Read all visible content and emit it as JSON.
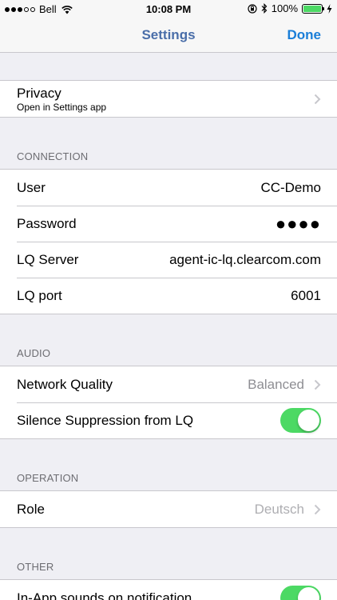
{
  "status_bar": {
    "carrier": "Bell",
    "time": "10:08 PM",
    "battery": "100%"
  },
  "nav": {
    "title": "Settings",
    "done_label": "Done"
  },
  "privacy": {
    "label": "Privacy",
    "sublabel": "Open in Settings app"
  },
  "sections": {
    "connection": {
      "header": "CONNECTION",
      "user_label": "User",
      "user_value": "CC-Demo",
      "password_label": "Password",
      "password_value": "●●●●",
      "server_label": "LQ Server",
      "server_value": "agent-ic-lq.clearcom.com",
      "port_label": "LQ port",
      "port_value": "6001"
    },
    "audio": {
      "header": "AUDIO",
      "quality_label": "Network Quality",
      "quality_value": "Balanced",
      "silence_label": "Silence Suppression from LQ",
      "silence_on": true
    },
    "operation": {
      "header": "OPERATION",
      "role_label": "Role",
      "role_value": "Deutsch"
    },
    "other": {
      "header": "OTHER",
      "sounds_label": "In-App sounds on notification",
      "sounds_on": true
    }
  },
  "colors": {
    "accent": "#1a7ed8",
    "toggle_on": "#4cd964",
    "background": "#efeff4"
  }
}
